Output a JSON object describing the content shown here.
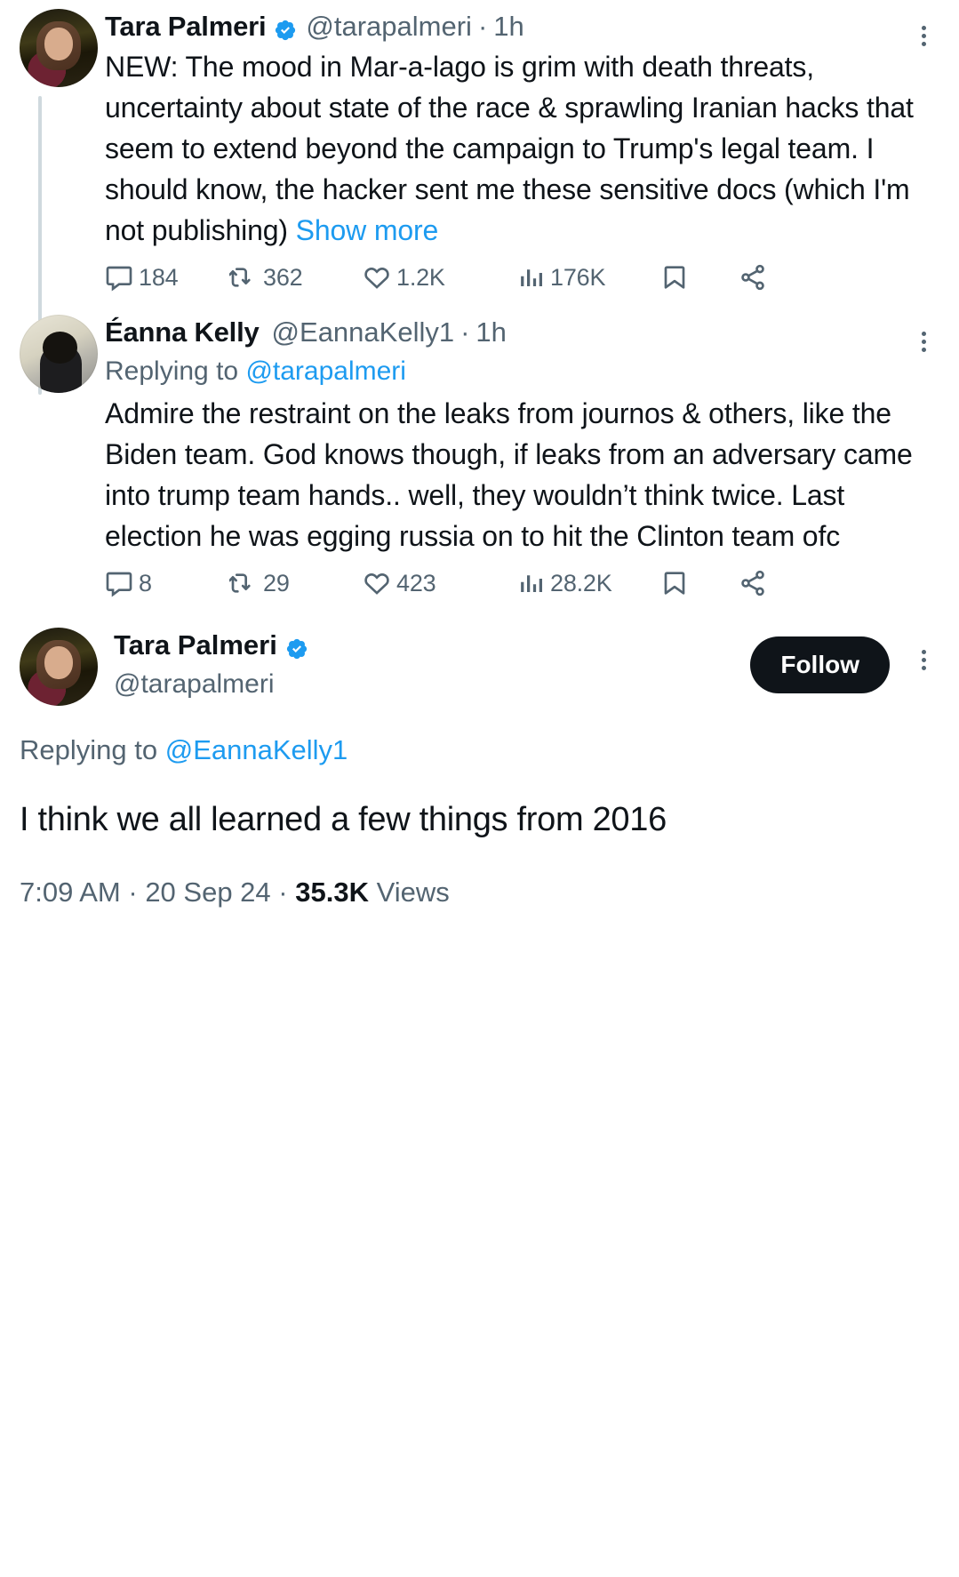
{
  "colors": {
    "accent": "#1d9bf0",
    "text": "#0f1419",
    "muted": "#536471",
    "thread_line": "#cfd9de",
    "follow_bg": "#0f1419"
  },
  "tweets": [
    {
      "id": "tweet-1",
      "display_name": "Tara Palmeri",
      "verified": true,
      "handle": "@tarapalmeri",
      "separator": "·",
      "timestamp": "1h",
      "text": "NEW: The mood in Mar-a-lago is grim with death threats, uncertainty about state of the race & sprawling Iranian hacks that seem to extend beyond the campaign to Trump's legal team. I should know, the hacker sent me these sensitive docs (which I'm not publishing) ",
      "show_more": "Show more",
      "stats": {
        "replies": "184",
        "reposts": "362",
        "likes": "1.2K",
        "views": "176K"
      }
    },
    {
      "id": "tweet-2",
      "display_name": "Éanna Kelly",
      "verified": false,
      "handle": "@EannaKelly1",
      "separator": "·",
      "timestamp": "1h",
      "replying_to_label": "Replying to ",
      "replying_to_handle": "@tarapalmeri",
      "text": "Admire the restraint on the leaks from journos & others, like the Biden team. God knows though, if leaks from an adversary came into trump team hands.. well, they wouldn’t think twice. Last election he was egging russia on to hit the Clinton team ofc",
      "stats": {
        "replies": "8",
        "reposts": "29",
        "likes": "423",
        "views": "28.2K"
      }
    }
  ],
  "focused_tweet": {
    "id": "tweet-3",
    "display_name": "Tara Palmeri",
    "verified": true,
    "handle": "@tarapalmeri",
    "follow_label": "Follow",
    "replying_to_label": "Replying to ",
    "replying_to_handle": "@EannaKelly1",
    "text": "I think we all learned a few things from 2016",
    "time": "7:09 AM",
    "sep1": " · ",
    "date": "20 Sep 24",
    "sep2": " · ",
    "views_count": "35.3K",
    "views_label": " Views"
  },
  "icons": {
    "reply": "reply-icon",
    "repost": "repost-icon",
    "like": "like-icon",
    "views": "views-icon",
    "bookmark": "bookmark-icon",
    "share": "share-icon",
    "more": "more-options-icon",
    "verified": "verified-badge-icon"
  }
}
